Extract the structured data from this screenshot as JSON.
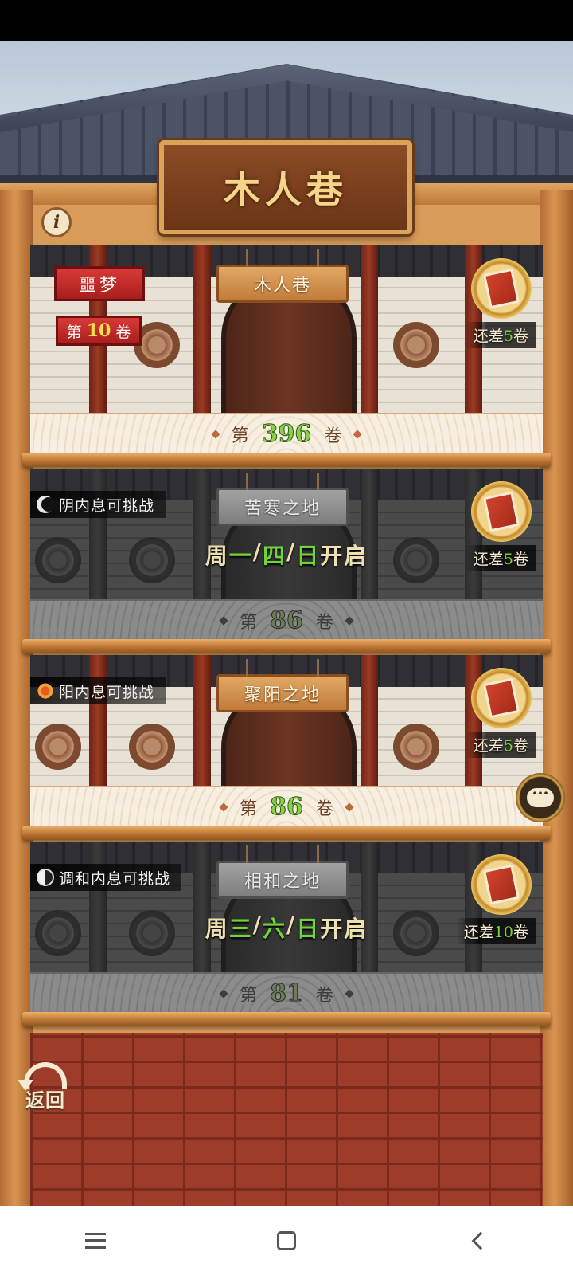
{
  "header": {
    "title": "木人巷",
    "info_icon": "info-icon"
  },
  "levels": [
    {
      "plaque": "木人巷",
      "floor_prefix": "第",
      "floor_number": "396",
      "floor_suffix": "卷",
      "reward_text_prefix": "还差",
      "reward_count": "5",
      "reward_text_suffix": "卷",
      "nightmare_label": "噩梦",
      "nightmare_level_prefix": "第",
      "nightmare_level": "10",
      "nightmare_level_suffix": "卷",
      "locked": false
    },
    {
      "tag": "阴内息可挑战",
      "tag_icon": "moon-icon",
      "plaque": "苦寒之地",
      "open_days": [
        "周",
        "一",
        "/",
        "四",
        "/",
        "日",
        "开启"
      ],
      "floor_prefix": "第",
      "floor_number": "86",
      "floor_suffix": "卷",
      "reward_text_prefix": "还差",
      "reward_count": "5",
      "reward_text_suffix": "卷",
      "locked": true
    },
    {
      "tag": "阳内息可挑战",
      "tag_icon": "sun-icon",
      "plaque": "聚阳之地",
      "floor_prefix": "第",
      "floor_number": "86",
      "floor_suffix": "卷",
      "reward_text_prefix": "还差",
      "reward_count": "5",
      "reward_text_suffix": "卷",
      "locked": false
    },
    {
      "tag": "调和内息可挑战",
      "tag_icon": "yin-yang-icon",
      "plaque": "相和之地",
      "open_days": [
        "周",
        "三",
        "/",
        "六",
        "/",
        "日",
        "开启"
      ],
      "floor_prefix": "第",
      "floor_number": "81",
      "floor_suffix": "卷",
      "reward_text_prefix": "还差",
      "reward_count": "10",
      "reward_text_suffix": "卷",
      "locked": true
    }
  ],
  "back_button": {
    "label": "返回"
  },
  "chat_icon": "chat-bubble-icon",
  "nav": {
    "menu_icon": "menu-icon",
    "home_icon": "home-icon",
    "back_icon": "back-chevron-icon"
  },
  "colors": {
    "accent_green": "#6fd43a",
    "wood": "#d89b59",
    "nightmare_red": "#c42a26"
  }
}
